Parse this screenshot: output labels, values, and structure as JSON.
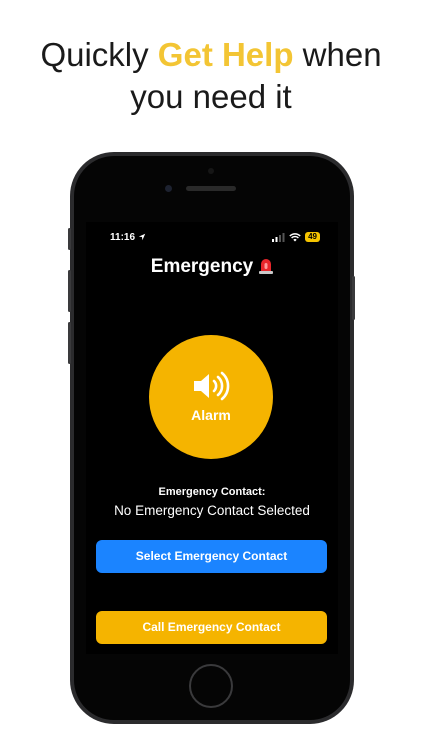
{
  "headline": {
    "prefix": "Quickly",
    "highlight": "Get Help",
    "suffix": "when",
    "line2": "you need it",
    "highlight_color": "#f3c534"
  },
  "status_bar": {
    "time": "11:16",
    "battery": "49",
    "icons": [
      "location-arrow-icon",
      "signal-icon",
      "wifi-icon",
      "battery-icon"
    ]
  },
  "app": {
    "title": "Emergency",
    "title_icon": "siren-icon",
    "alarm_label": "Alarm",
    "alarm_icon": "speaker-icon",
    "contact_label": "Emergency Contact:",
    "contact_value": "No Emergency Contact Selected",
    "select_button": "Select Emergency Contact",
    "call_button": "Call Emergency Contact"
  },
  "colors": {
    "accent_yellow": "#f5b400",
    "accent_blue": "#1b84ff",
    "screen_bg": "#000000"
  }
}
